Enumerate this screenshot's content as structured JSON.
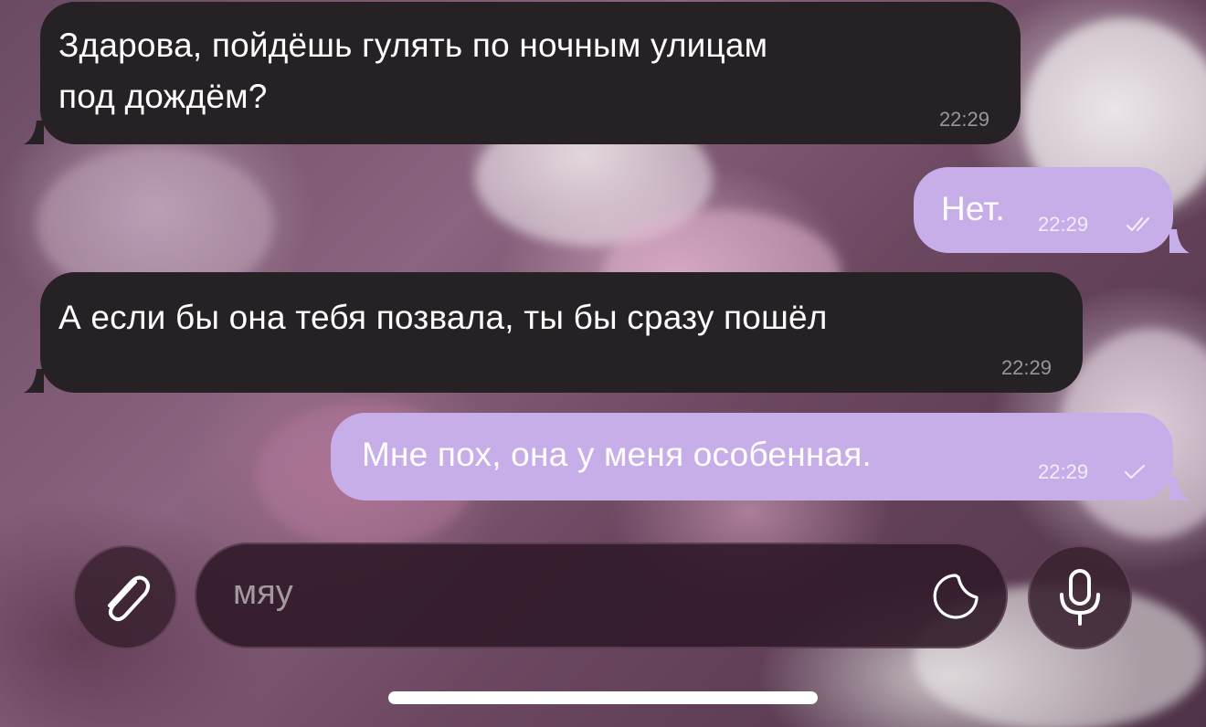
{
  "colors": {
    "incoming_bubble": "#262124",
    "outgoing_bubble": "#c7aee9",
    "text": "#ffffff",
    "placeholder": "#a39aa0"
  },
  "messages": [
    {
      "direction": "incoming",
      "lines": [
        "Здарова, пойдёшь гулять по ночным улицам",
        "под дождём?"
      ],
      "time": "22:29"
    },
    {
      "direction": "outgoing",
      "lines": [
        "Нет."
      ],
      "time": "22:29",
      "status": "read-double-check-icon"
    },
    {
      "direction": "incoming",
      "lines": [
        "А если бы она тебя позвала, ты бы сразу пошёл"
      ],
      "time": "22:29"
    },
    {
      "direction": "outgoing",
      "lines": [
        "Мне пох, она у меня особенная."
      ],
      "time": "22:29",
      "status": "sent-single-check-icon"
    }
  ],
  "input_bar": {
    "attach_icon": "paperclip-icon",
    "placeholder": "мяу",
    "sticker_icon": "sticker-icon",
    "mic_icon": "microphone-icon"
  }
}
